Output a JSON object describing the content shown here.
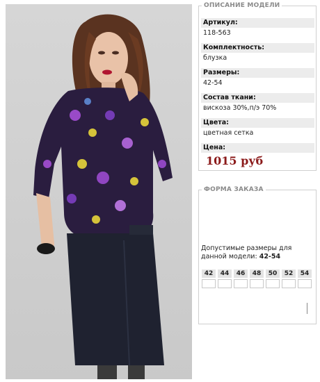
{
  "description": {
    "legend": "ОПИСАНИЕ МОДЕЛИ",
    "fields": [
      {
        "label": "Артикул:",
        "value": "118-563"
      },
      {
        "label": "Комплектность:",
        "value": "блузка"
      },
      {
        "label": "Размеры:",
        "value": "42-54"
      },
      {
        "label": "Состав ткани:",
        "value": "вискоза 30%,п/э 70%"
      },
      {
        "label": "Цвета:",
        "value": "цветная сетка"
      }
    ],
    "price_label": "Цена:",
    "price": "1015 руб"
  },
  "order": {
    "legend": "ФОРМА ЗАКАЗА",
    "allowed_text": "Допустимые размеры для данной модели:",
    "allowed_sizes": "42-54",
    "sizes": [
      "42",
      "44",
      "46",
      "48",
      "50",
      "52",
      "54"
    ]
  },
  "colors": {
    "price": "#8b1a1a",
    "label_bg": "#ececec",
    "legend": "#8a8a8a"
  }
}
